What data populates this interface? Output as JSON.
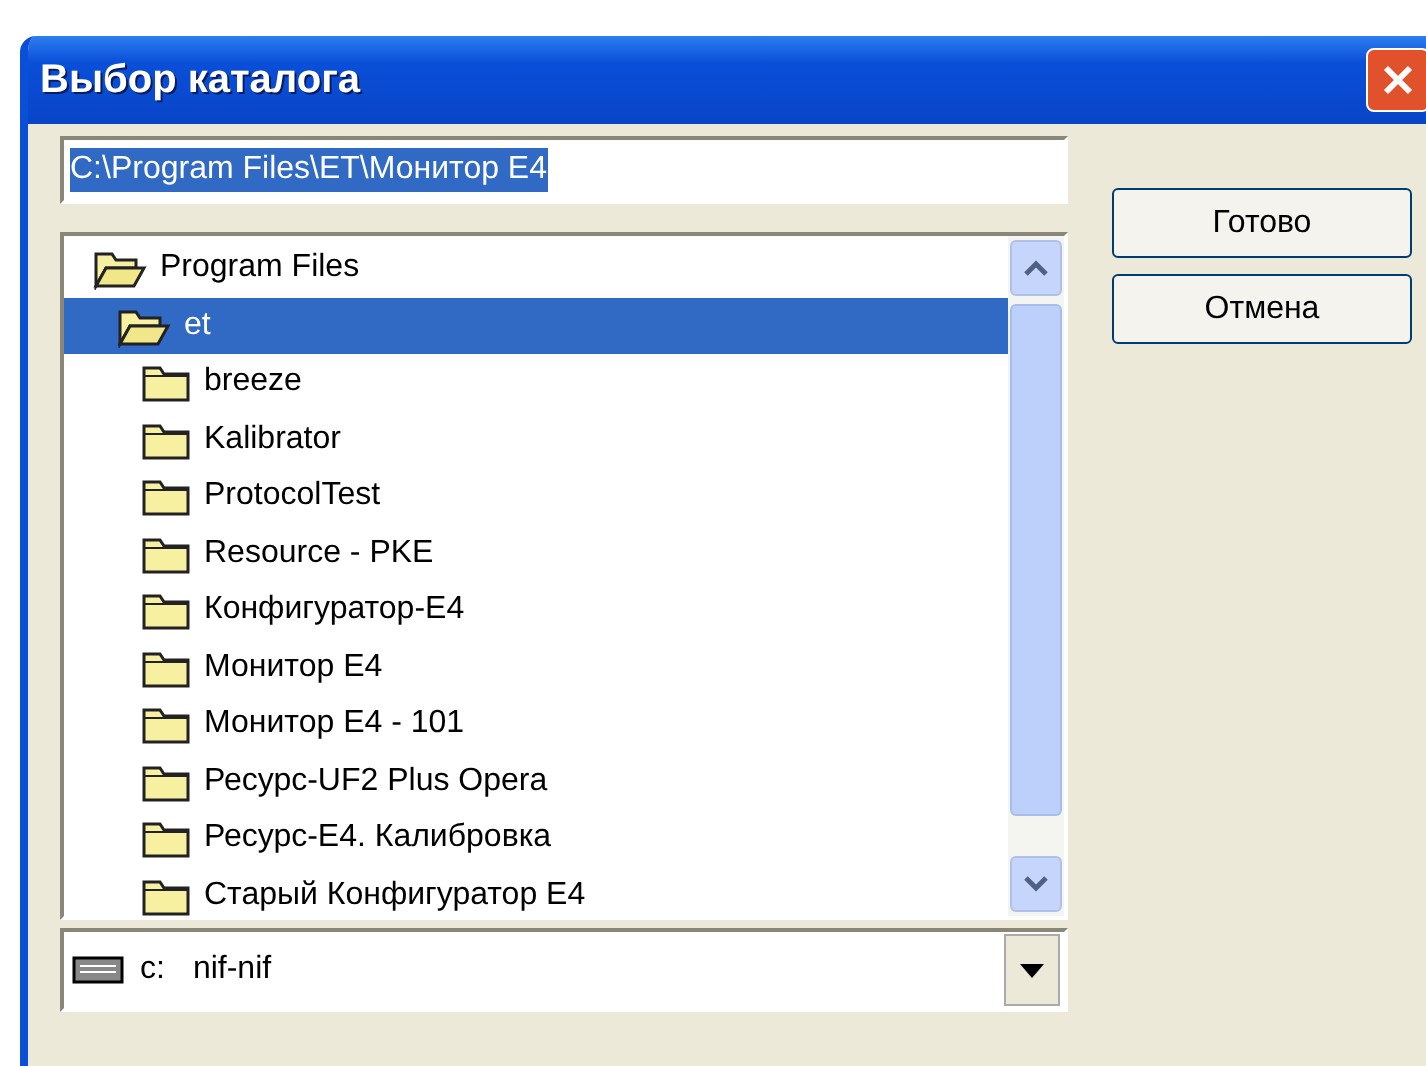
{
  "window": {
    "title": "Выбор каталога"
  },
  "path_field": {
    "value": "C:\\Program Files\\ET\\Монитор E4"
  },
  "buttons": [
    "Готово",
    "Отмена"
  ],
  "tree": [
    {
      "label": "Program Files",
      "expanded": true,
      "selected": false,
      "children": [
        {
          "label": "et",
          "expanded": true,
          "selected": true,
          "children": [
            {
              "label": "breeze",
              "expanded": false,
              "selected": false
            },
            {
              "label": "Kalibrator",
              "expanded": false,
              "selected": false
            },
            {
              "label": "ProtocolTest",
              "expanded": false,
              "selected": false
            },
            {
              "label": "Resource - PKE",
              "expanded": false,
              "selected": false
            },
            {
              "label": "Конфигуратор-E4",
              "expanded": false,
              "selected": false
            },
            {
              "label": "Монитор E4",
              "expanded": false,
              "selected": false
            },
            {
              "label": "Монитор E4 - 101",
              "expanded": false,
              "selected": false
            },
            {
              "label": "Ресурс-UF2 Plus Opera",
              "expanded": false,
              "selected": false
            },
            {
              "label": "Ресурс-E4. Калибровка",
              "expanded": false,
              "selected": false
            },
            {
              "label": "Старый Конфигуратор E4",
              "expanded": false,
              "selected": false
            }
          ]
        }
      ]
    }
  ],
  "drive": {
    "letter": "c:",
    "name": "nif-nif"
  }
}
